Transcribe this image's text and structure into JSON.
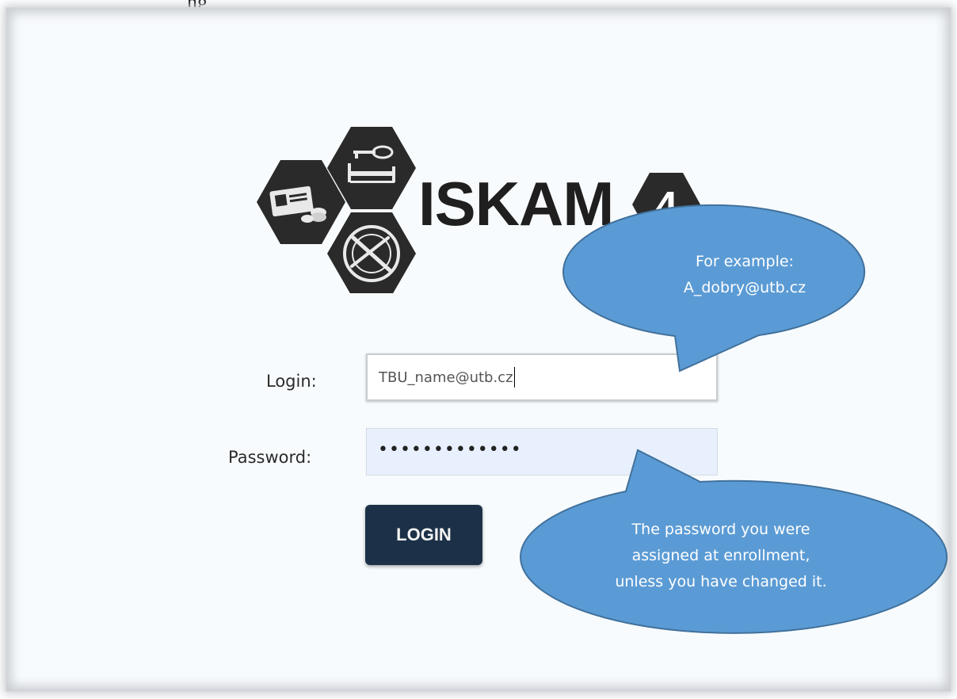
{
  "page": {
    "top_fragment": "ng"
  },
  "logo": {
    "text": "ISKAM",
    "badge_number": "4",
    "icons": [
      "id-card-coins-icon",
      "key-bed-icon",
      "plate-cutlery-icon"
    ]
  },
  "form": {
    "login_label": "Login:",
    "login_value": "TBU_name@utb.cz",
    "password_label": "Password:",
    "password_value": "•••••••••••••",
    "login_button_label": "LOGIN"
  },
  "callouts": {
    "login_hint_line1": "For example:",
    "login_hint_line2": "A_dobry@utb.cz",
    "password_hint_line1": "The password you were",
    "password_hint_line2": "assigned at enrollment,",
    "password_hint_line3": "unless you have changed it."
  },
  "colors": {
    "callout_fill": "#5b9bd5",
    "callout_stroke": "#41719c",
    "button_bg": "#1c3148",
    "logo_dark": "#2a2a2a",
    "password_autofill_bg": "#e8f0fe"
  }
}
